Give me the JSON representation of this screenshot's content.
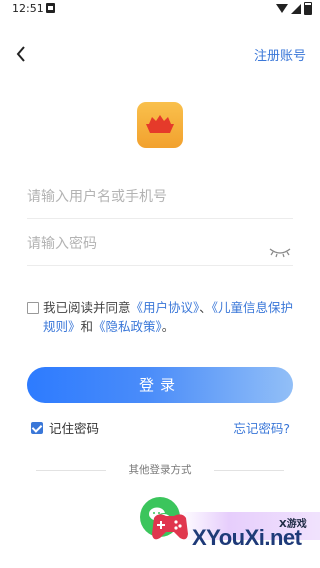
{
  "status_bar": {
    "time": "12:51"
  },
  "header": {
    "register_label": "注册账号"
  },
  "form": {
    "username_placeholder": "请输入用户名或手机号",
    "password_placeholder": "请输入密码"
  },
  "agreement": {
    "prefix": "我已阅读并同意",
    "user_agreement": "《用户协议》",
    "sep1": "、",
    "child_policy": "《儿童信息保护规则》",
    "sep2": "和",
    "privacy_policy": "《隐私政策》",
    "suffix": "。"
  },
  "login_button": "登录",
  "remember_label": "记住密码",
  "forgot_label": "忘记密码?",
  "other_login_label": "其他登录方式",
  "watermark": {
    "text": "XYouXi.net",
    "small": "X游戏"
  },
  "colors": {
    "accent": "#3a77d8",
    "button_start": "#2d7bff",
    "button_end": "#92bff7",
    "wechat": "#3bc55c",
    "logo": "#f5ad35"
  },
  "icons": [
    "back-arrow-icon",
    "app-logo-icon",
    "eye-closed-icon",
    "wechat-icon",
    "checkbox-checked-icon"
  ]
}
